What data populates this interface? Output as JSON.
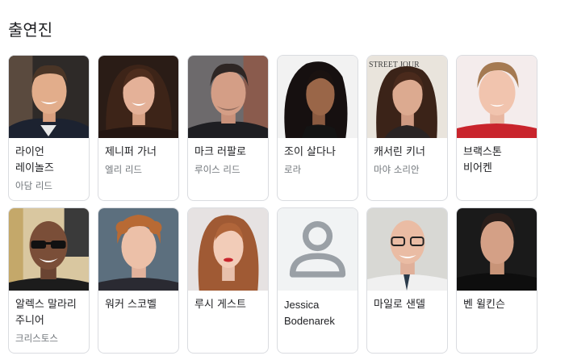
{
  "section": {
    "title": "출연진"
  },
  "cast": [
    {
      "name": "라이언 레이놀즈",
      "role": "아담 리드"
    },
    {
      "name": "제니퍼 가너",
      "role": "엘리 리드"
    },
    {
      "name": "마크 러팔로",
      "role": "루이스 리드"
    },
    {
      "name": "조이 살다나",
      "role": "로라"
    },
    {
      "name": "캐서린 키너",
      "role": "마야 소리안"
    },
    {
      "name": "브랙스톤 비어켄",
      "role": ""
    },
    {
      "name": "알렉스 말라리 주니어",
      "role": "크리스토스"
    },
    {
      "name": "워커 스코벨",
      "role": ""
    },
    {
      "name": "루시 게스트",
      "role": ""
    },
    {
      "name": "Jessica Bodenarek",
      "role": ""
    },
    {
      "name": "마일로 샌델",
      "role": ""
    },
    {
      "name": "벤 윌킨슨",
      "role": ""
    }
  ],
  "colors": {
    "border": "#dadce0",
    "secondary_text": "#70757a",
    "placeholder_bg": "#f1f3f4",
    "placeholder_icon": "#9aa0a6"
  },
  "icons": {
    "placeholder": "person-icon"
  }
}
